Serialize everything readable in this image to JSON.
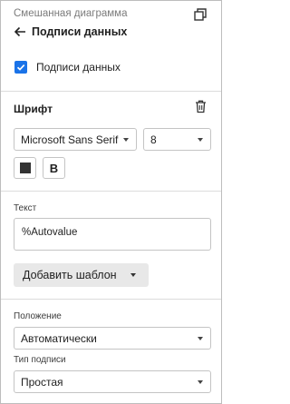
{
  "header": {
    "caption": "Смешанная диаграмма",
    "title": "Подписи данных"
  },
  "data_labels": {
    "label": "Подписи данных",
    "checked": true
  },
  "font_section": {
    "title": "Шрифт",
    "family": "Microsoft Sans Serif",
    "size": "8",
    "bold_label": "B",
    "color": "#333333"
  },
  "text_section": {
    "label": "Текст",
    "value": "%Autovalue",
    "add_template_label": "Добавить шаблон"
  },
  "position": {
    "label": "Положение",
    "value": "Автоматически"
  },
  "label_type": {
    "label": "Тип подписи",
    "value": "Простая"
  },
  "colors": {
    "accent": "#1a73e8",
    "border": "#c4c4c4",
    "divider": "#dcdcdc",
    "button_bg": "#e8e8e8"
  }
}
